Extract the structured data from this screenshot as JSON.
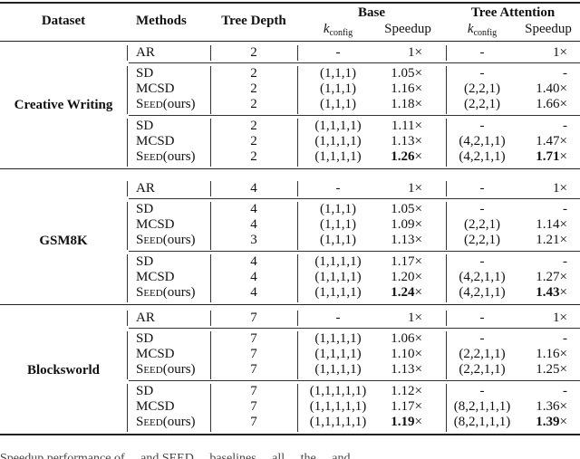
{
  "header": {
    "dataset": "Dataset",
    "methods": "Methods",
    "tree_depth": "Tree Depth",
    "base": "Base",
    "tree_attention": "Tree Attention",
    "k_letter": "k",
    "k_sub": "config",
    "speedup": "Speedup"
  },
  "datasets": [
    {
      "name": "Creative Writing",
      "ar": {
        "method": "AR",
        "depth": "2",
        "base_k": "-",
        "base_speedup": "1×",
        "ta_k": "-",
        "ta_speedup": "1×"
      },
      "groups": [
        [
          {
            "method": "SD",
            "depth": "2",
            "base_k": "(1,1,1)",
            "base_speedup": "1.05×",
            "ta_k": "-",
            "ta_speedup": "-"
          },
          {
            "method": "MCSD",
            "depth": "2",
            "base_k": "(1,1,1)",
            "base_speedup": "1.16×",
            "ta_k": "(2,2,1)",
            "ta_speedup": "1.40×"
          },
          {
            "method": "SEED",
            "method_suffix": "(ours)",
            "depth": "2",
            "base_k": "(1,1,1)",
            "base_speedup": "1.18×",
            "ta_k": "(2,2,1)",
            "ta_speedup": "1.66×"
          }
        ],
        [
          {
            "method": "SD",
            "depth": "2",
            "base_k": "(1,1,1,1)",
            "base_speedup": "1.11×",
            "ta_k": "-",
            "ta_speedup": "-"
          },
          {
            "method": "MCSD",
            "depth": "2",
            "base_k": "(1,1,1,1)",
            "base_speedup": "1.13×",
            "ta_k": "(4,2,1,1)",
            "ta_speedup": "1.47×"
          },
          {
            "method": "SEED",
            "method_suffix": "(ours)",
            "depth": "2",
            "base_k": "(1,1,1,1)",
            "base_speedup": "1.26×",
            "ta_k": "(4,2,1,1)",
            "ta_speedup": "1.71×",
            "bold": true
          }
        ]
      ]
    },
    {
      "name": "GSM8K",
      "ar": {
        "method": "AR",
        "depth": "4",
        "base_k": "-",
        "base_speedup": "1×",
        "ta_k": "-",
        "ta_speedup": "1×"
      },
      "groups": [
        [
          {
            "method": "SD",
            "depth": "4",
            "base_k": "(1,1,1)",
            "base_speedup": "1.05×",
            "ta_k": "-",
            "ta_speedup": "-"
          },
          {
            "method": "MCSD",
            "depth": "4",
            "base_k": "(1,1,1)",
            "base_speedup": "1.09×",
            "ta_k": "(2,2,1)",
            "ta_speedup": "1.14×"
          },
          {
            "method": "SEED",
            "method_suffix": "(ours)",
            "depth": "3",
            "base_k": "(1,1,1)",
            "base_speedup": "1.13×",
            "ta_k": "(2,2,1)",
            "ta_speedup": "1.21×"
          }
        ],
        [
          {
            "method": "SD",
            "depth": "4",
            "base_k": "(1,1,1,1)",
            "base_speedup": "1.17×",
            "ta_k": "-",
            "ta_speedup": "-"
          },
          {
            "method": "MCSD",
            "depth": "4",
            "base_k": "(1,1,1,1)",
            "base_speedup": "1.20×",
            "ta_k": "(4,2,1,1)",
            "ta_speedup": "1.27×"
          },
          {
            "method": "SEED",
            "method_suffix": "(ours)",
            "depth": "4",
            "base_k": "(1,1,1,1)",
            "base_speedup": "1.24×",
            "ta_k": "(4,2,1,1)",
            "ta_speedup": "1.43×",
            "bold": true
          }
        ]
      ]
    },
    {
      "name": "Blocksworld",
      "ar": {
        "method": "AR",
        "depth": "7",
        "base_k": "-",
        "base_speedup": "1×",
        "ta_k": "-",
        "ta_speedup": "1×"
      },
      "groups": [
        [
          {
            "method": "SD",
            "depth": "7",
            "base_k": "(1,1,1,1)",
            "base_speedup": "1.06×",
            "ta_k": "-",
            "ta_speedup": "-"
          },
          {
            "method": "MCSD",
            "depth": "7",
            "base_k": "(1,1,1,1)",
            "base_speedup": "1.10×",
            "ta_k": "(2,2,1,1)",
            "ta_speedup": "1.16×"
          },
          {
            "method": "SEED",
            "method_suffix": "(ours)",
            "depth": "7",
            "base_k": "(1,1,1,1)",
            "base_speedup": "1.13×",
            "ta_k": "(2,2,1,1)",
            "ta_speedup": "1.25×"
          }
        ],
        [
          {
            "method": "SD",
            "depth": "7",
            "base_k": "(1,1,1,1,1)",
            "base_speedup": "1.12×",
            "ta_k": "-",
            "ta_speedup": "-"
          },
          {
            "method": "MCSD",
            "depth": "7",
            "base_k": "(1,1,1,1,1)",
            "base_speedup": "1.17×",
            "ta_k": "(8,2,1,1,1)",
            "ta_speedup": "1.36×"
          },
          {
            "method": "SEED",
            "method_suffix": "(ours)",
            "depth": "7",
            "base_k": "(1,1,1,1,1)",
            "base_speedup": "1.19×",
            "ta_k": "(8,2,1,1,1)",
            "ta_speedup": "1.39×",
            "bold": true
          }
        ]
      ]
    }
  ],
  "caption_fragment": "Speedup performance of ... and SEED ... baselines ... all ... the ... and ..."
}
